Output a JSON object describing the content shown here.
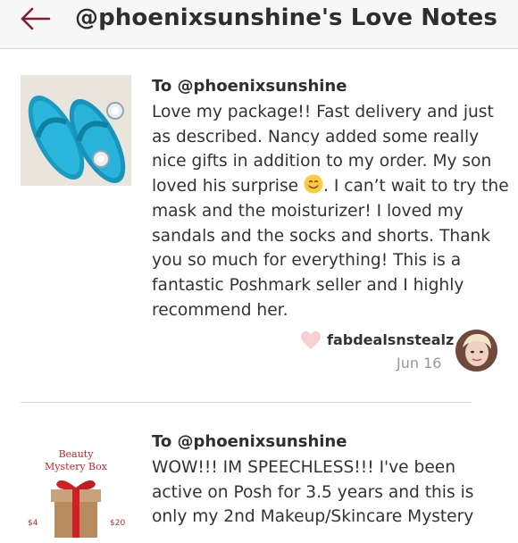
{
  "header": {
    "title": "@phoenixsunshine's Love Notes",
    "back_icon": "back-arrow-icon",
    "accent_color": "#7f1e2e"
  },
  "notes": [
    {
      "to": "To @phoenixsunshine",
      "message_before_emoji": "Love my package!! Fast delivery and just as described. Nancy added some really nice gifts in addition to my order. My son loved his surprise ",
      "emoji": "smiling-face-emoji",
      "message_after_emoji": ". I can’t wait to try the mask and the moisturizer! I loved my sandals and the socks and shorts. Thank you so much for everything! This is a fantastic Poshmark seller and I highly recommend her.",
      "author": "fabdealsnstealz",
      "date": "Jun 16",
      "heart_icon": "heart-icon",
      "thumbnail": "blue-jelly-sandals-image"
    },
    {
      "to": "To @phoenixsunshine",
      "message": "WOW!!! IM SPEECHLESS!!! I've been active on Posh for 3.5 years and this is only my 2nd Makeup/Skincare Mystery",
      "thumbnail": "beauty-mystery-box-image",
      "thumbnail_text_1": "Beauty",
      "thumbnail_text_2": "Mystery Box"
    }
  ]
}
